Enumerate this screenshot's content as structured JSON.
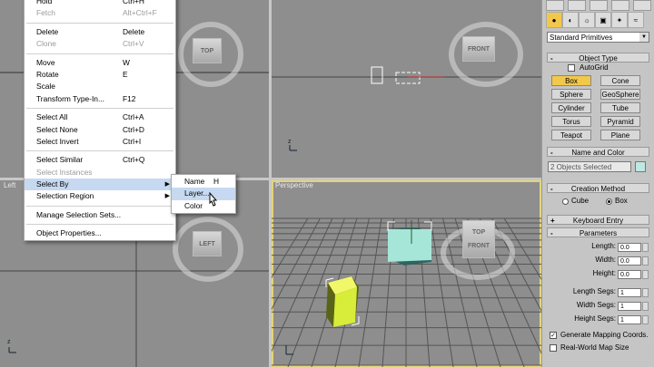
{
  "menu": {
    "items": [
      {
        "label": "Hold",
        "shortcut": "Ctrl+H"
      },
      {
        "label": "Fetch",
        "shortcut": "Alt+Ctrl+F",
        "disabled": true
      },
      {
        "sep": true
      },
      {
        "label": "Delete",
        "shortcut": "Delete"
      },
      {
        "label": "Clone",
        "shortcut": "Ctrl+V",
        "disabled": true
      },
      {
        "sep": true
      },
      {
        "label": "Move",
        "shortcut": "W"
      },
      {
        "label": "Rotate",
        "shortcut": "E"
      },
      {
        "label": "Scale",
        "shortcut": ""
      },
      {
        "label": "Transform Type-In...",
        "shortcut": "F12"
      },
      {
        "sep": true
      },
      {
        "label": "Select All",
        "shortcut": "Ctrl+A"
      },
      {
        "label": "Select None",
        "shortcut": "Ctrl+D"
      },
      {
        "label": "Select Invert",
        "shortcut": "Ctrl+I"
      },
      {
        "sep": true
      },
      {
        "label": "Select Similar",
        "shortcut": "Ctrl+Q"
      },
      {
        "label": "Select Instances",
        "shortcut": "",
        "disabled": true
      },
      {
        "label": "Select By",
        "shortcut": "",
        "submenu": true,
        "highlight": true
      },
      {
        "label": "Selection Region",
        "shortcut": "",
        "submenu": true
      },
      {
        "sep": true
      },
      {
        "label": "Manage Selection Sets...",
        "shortcut": ""
      },
      {
        "sep": true
      },
      {
        "label": "Object Properties...",
        "shortcut": ""
      }
    ]
  },
  "submenu": {
    "items": [
      {
        "label": "Name",
        "shortcut": "H"
      },
      {
        "label": "Layer...",
        "shortcut": "",
        "highlight": true
      },
      {
        "label": "Color",
        "shortcut": ""
      }
    ]
  },
  "viewports": {
    "top": {
      "cube": "TOP"
    },
    "front": {
      "cube": "FRONT"
    },
    "left": {
      "label": "Left",
      "cube": "LEFT"
    },
    "perspective": {
      "label": "Perspective",
      "cube_top": "TOP",
      "cube_front": "FRONT"
    }
  },
  "panel": {
    "category": "Standard Primitives",
    "object_type": {
      "title": "Object Type",
      "autogrid": "AutoGrid",
      "buttons": [
        "Box",
        "Cone",
        "Sphere",
        "GeoSphere",
        "Cylinder",
        "Tube",
        "Torus",
        "Pyramid",
        "Teapot",
        "Plane"
      ],
      "selected": "Box"
    },
    "name_color": {
      "title": "Name and Color",
      "value": "2 Objects Selected",
      "swatch": "#bfe8e2"
    },
    "creation": {
      "title": "Creation Method",
      "options": [
        "Cube",
        "Box"
      ],
      "selected": "Box"
    },
    "keyboard": {
      "title": "Keyboard Entry"
    },
    "params": {
      "title": "Parameters",
      "fields": [
        {
          "label": "Length:",
          "value": "0.0"
        },
        {
          "label": "Width:",
          "value": "0.0"
        },
        {
          "label": "Height:",
          "value": "0.0"
        },
        {
          "label": "Length Segs:",
          "value": "1"
        },
        {
          "label": "Width Segs:",
          "value": "1"
        },
        {
          "label": "Height Segs:",
          "value": "1"
        }
      ],
      "gen_mapping": "Generate Mapping Coords.",
      "real_world": "Real-World Map Size"
    }
  },
  "colors": {
    "accent": "#f2c84b",
    "active_border": "#e4d47a",
    "cube_cyan": "#a6e6d8",
    "cube_yellow": "#d8ec3a"
  }
}
